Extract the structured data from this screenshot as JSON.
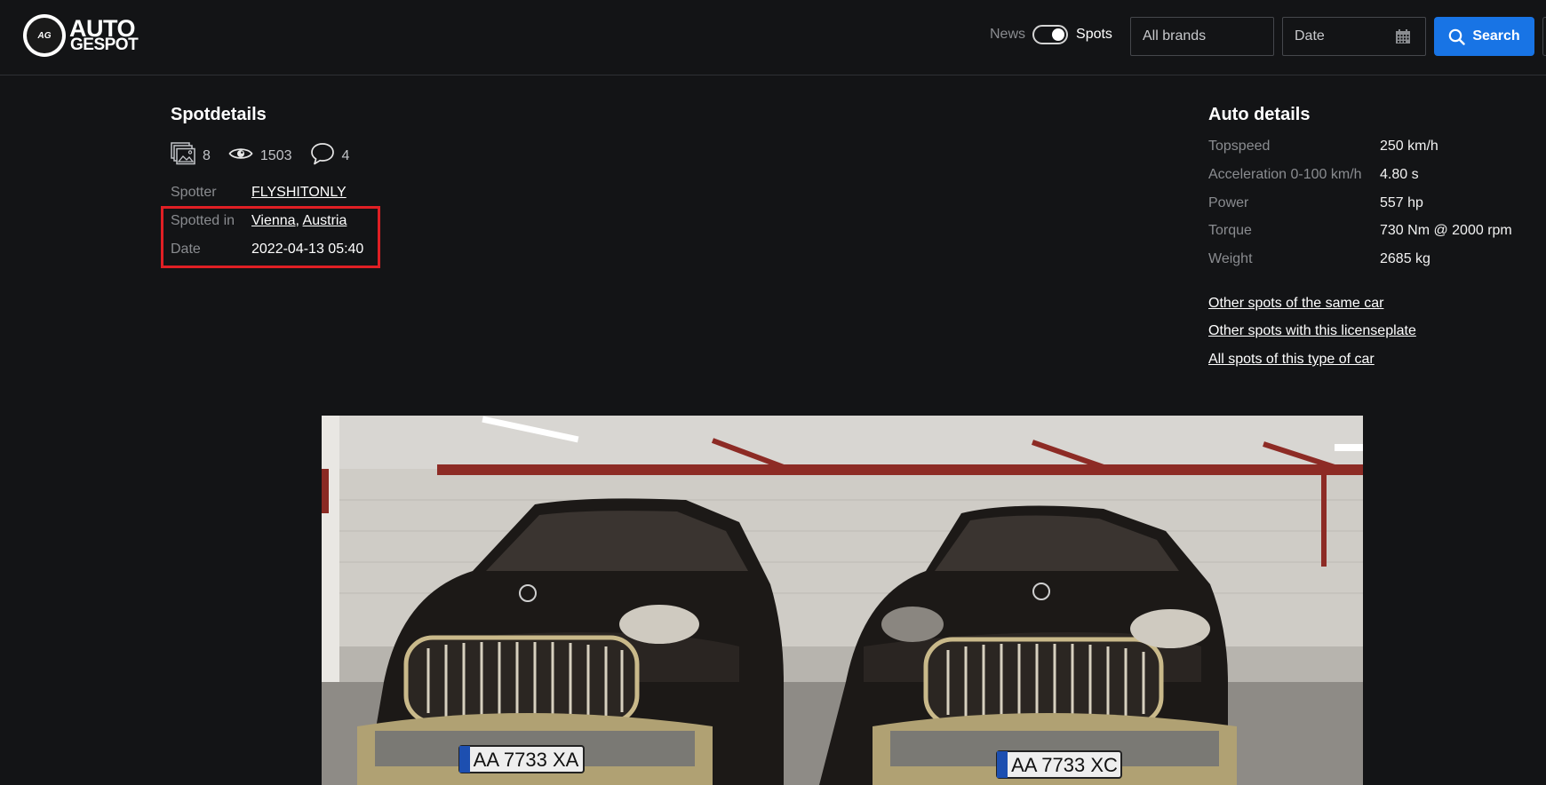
{
  "header": {
    "logo_line1": "AUTO",
    "logo_line2": "GESPOT",
    "logo_badge": "AG",
    "toggle_left": "News",
    "toggle_right": "Spots",
    "brands_placeholder": "All brands",
    "date_placeholder": "Date",
    "search_label": "Search"
  },
  "spot": {
    "title": "Spotdetails",
    "photos_count": "8",
    "views_count": "1503",
    "comments_count": "4",
    "spotter_label": "Spotter",
    "spotter_value": "FLYSHITONLY",
    "location_label": "Spotted in",
    "city": "Vienna",
    "separator": ",",
    "country": "Austria",
    "date_label": "Date",
    "date_value": "2022-04-13 05:40"
  },
  "auto": {
    "title": "Auto details",
    "specs": [
      {
        "label": "Topspeed",
        "value": "250 km/h"
      },
      {
        "label": "Acceleration 0-100 km/h",
        "value": "4.80 s"
      },
      {
        "label": "Power",
        "value": "557 hp"
      },
      {
        "label": "Torque",
        "value": "730 Nm @ 2000 rpm"
      },
      {
        "label": "Weight",
        "value": "2685 kg"
      }
    ],
    "links": [
      "Other spots of the same car",
      "Other spots with this licenseplate",
      "All spots of this type of car"
    ]
  },
  "photo": {
    "plate_left": "AA 7733 XA",
    "plate_right": "AA 7733 XC",
    "plate_country": "UA"
  },
  "colors": {
    "accent": "#1874e5",
    "highlight": "#e01f24",
    "background": "#131416"
  },
  "icons": {
    "photos": "photos-icon",
    "views": "eye-icon",
    "comments": "comment-icon",
    "calendar": "calendar-icon",
    "search": "search-icon"
  }
}
